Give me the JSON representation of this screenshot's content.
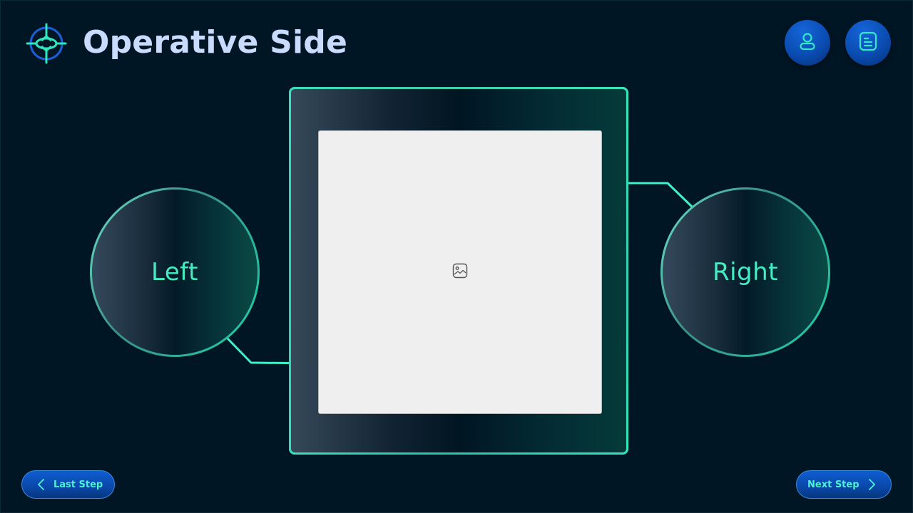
{
  "header": {
    "title": "Operative Side",
    "logo_icon": "target-compass-icon",
    "profile_icon": "user-icon",
    "notes_icon": "document-list-icon"
  },
  "main": {
    "image_placeholder_icon": "image-icon",
    "left_option": {
      "label": "Left"
    },
    "right_option": {
      "label": "Right"
    }
  },
  "footer": {
    "prev_label": "Last Step",
    "next_label": "Next Step"
  },
  "colors": {
    "background": "#001625",
    "accent": "#45ecc2",
    "title": "#c9dcff",
    "button_blue": "#0a4cb2"
  }
}
